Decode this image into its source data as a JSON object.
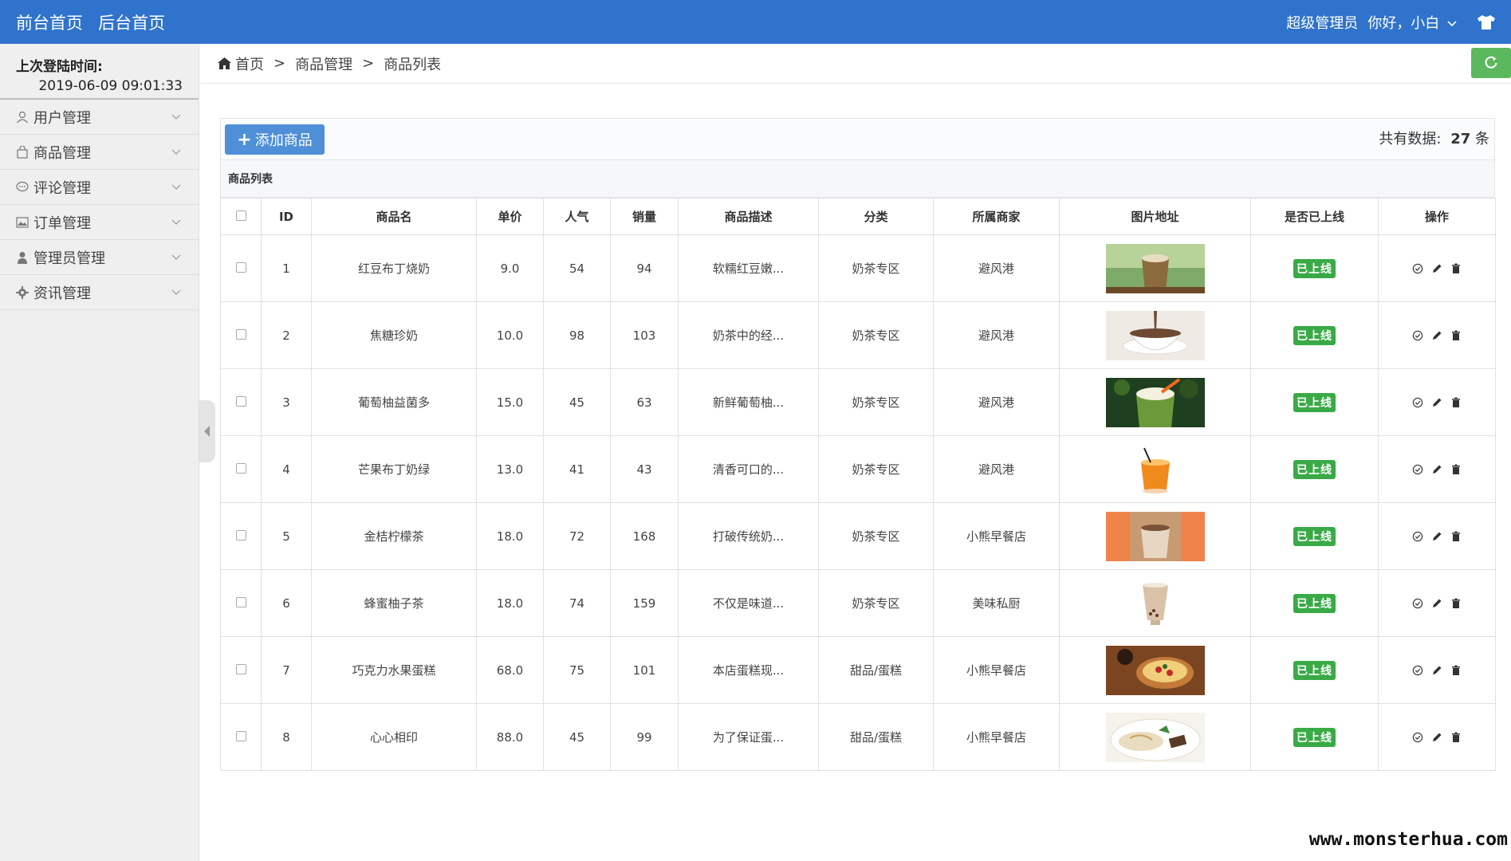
{
  "topbar": {
    "front_home": "前台首页",
    "back_home": "后台首页",
    "role": "超级管理员",
    "greeting": "你好，小白"
  },
  "sidebar": {
    "login_label": "上次登陆时间:",
    "login_time": "2019-06-09 09:01:33",
    "items": [
      {
        "label": "用户管理",
        "icon": "user-icon"
      },
      {
        "label": "商品管理",
        "icon": "bag-icon"
      },
      {
        "label": "评论管理",
        "icon": "comment-icon"
      },
      {
        "label": "订单管理",
        "icon": "image-icon"
      },
      {
        "label": "管理员管理",
        "icon": "person-icon"
      },
      {
        "label": "资讯管理",
        "icon": "gear-icon"
      }
    ]
  },
  "breadcrumb": {
    "home": "首页",
    "level1": "商品管理",
    "level2": "商品列表",
    "sep": ">"
  },
  "toolbar": {
    "add_label": "添加商品",
    "total_prefix": "共有数据:",
    "total_count": "27",
    "total_suffix": "条"
  },
  "panel": {
    "title": "商品列表"
  },
  "table": {
    "headers": [
      "ID",
      "商品名",
      "单价",
      "人气",
      "销量",
      "商品描述",
      "分类",
      "所属商家",
      "图片地址",
      "是否已上线",
      "操作"
    ],
    "status_label": "已上线",
    "rows": [
      {
        "id": "1",
        "name": "红豆布丁烧奶",
        "price": "9.0",
        "pop": "54",
        "sales": "94",
        "desc": "软糯红豆嫩...",
        "cat": "奶茶专区",
        "shop": "避风港",
        "img": "milk-tea-glass",
        "color1": "#8b6a3e",
        "color2": "#7faa6a"
      },
      {
        "id": "2",
        "name": "焦糖珍奶",
        "price": "10.0",
        "pop": "98",
        "sales": "103",
        "desc": "奶茶中的经...",
        "cat": "奶茶专区",
        "shop": "避风港",
        "img": "chocolate-cup",
        "color1": "#6e4a35",
        "color2": "#efeae4"
      },
      {
        "id": "3",
        "name": "葡萄柚益菌多",
        "price": "15.0",
        "pop": "45",
        "sales": "63",
        "desc": "新鲜葡萄柚...",
        "cat": "奶茶专区",
        "shop": "避风港",
        "img": "green-smoothie",
        "color1": "#6c9a3a",
        "color2": "#1f4020"
      },
      {
        "id": "4",
        "name": "芒果布丁奶绿",
        "price": "13.0",
        "pop": "41",
        "sales": "43",
        "desc": "清香可口的...",
        "cat": "奶茶专区",
        "shop": "避风港",
        "img": "orange-drink",
        "color1": "#f08a1c",
        "color2": "#ffffff"
      },
      {
        "id": "5",
        "name": "金桔柠檬茶",
        "price": "18.0",
        "pop": "72",
        "sales": "168",
        "desc": "打破传统奶...",
        "cat": "奶茶专区",
        "shop": "小熊早餐店",
        "img": "latte-orange-bg",
        "color1": "#f0834a",
        "color2": "#c89a72"
      },
      {
        "id": "6",
        "name": "蜂蜜柚子茶",
        "price": "18.0",
        "pop": "74",
        "sales": "159",
        "desc": "不仅是味道...",
        "cat": "奶茶专区",
        "shop": "美味私厨",
        "img": "bubble-tea-glass",
        "color1": "#d9c2a8",
        "color2": "#ffffff"
      },
      {
        "id": "7",
        "name": "巧克力水果蛋糕",
        "price": "68.0",
        "pop": "75",
        "sales": "101",
        "desc": "本店蛋糕现...",
        "cat": "甜品/蛋糕",
        "shop": "小熊早餐店",
        "img": "fruit-tart",
        "color1": "#7a4520",
        "color2": "#c47a3a"
      },
      {
        "id": "8",
        "name": "心心相印",
        "price": "88.0",
        "pop": "45",
        "sales": "99",
        "desc": "为了保证蛋...",
        "cat": "甜品/蛋糕",
        "shop": "小熊早餐店",
        "img": "cake-plate",
        "color1": "#e9dcc0",
        "color2": "#5a3a25"
      }
    ]
  },
  "watermark": "www.monsterhua.com"
}
